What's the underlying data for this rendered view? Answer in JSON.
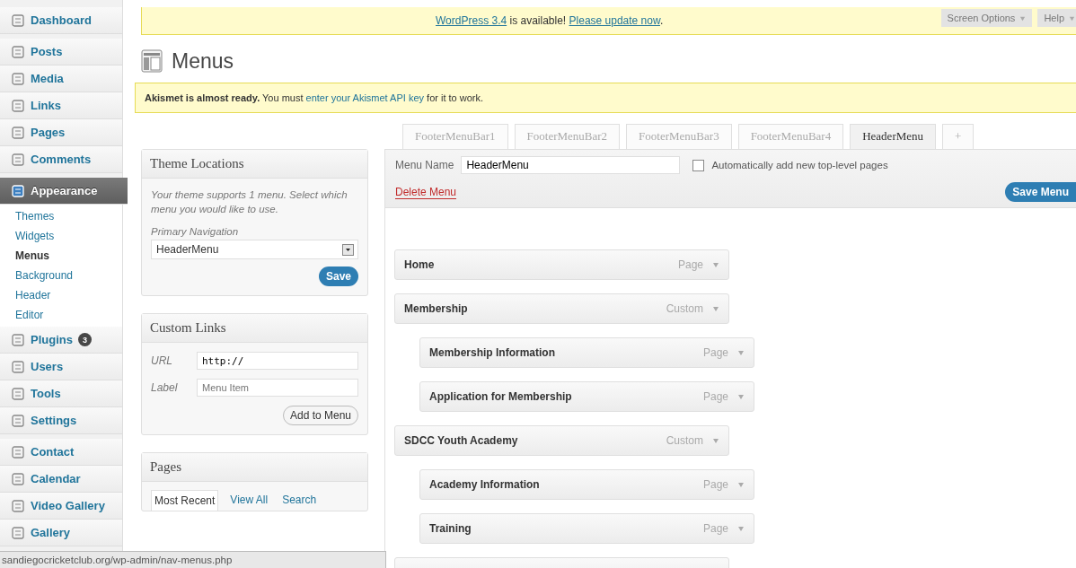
{
  "sidebar": {
    "groups": [
      {
        "items": [
          {
            "label": "Dashboard",
            "selected": false
          }
        ]
      },
      {
        "items": [
          {
            "label": "Posts",
            "selected": false
          },
          {
            "label": "Media",
            "selected": false
          },
          {
            "label": "Links",
            "selected": false
          },
          {
            "label": "Pages",
            "selected": false
          },
          {
            "label": "Comments",
            "selected": false
          }
        ]
      },
      {
        "items": [
          {
            "label": "Appearance",
            "selected": true,
            "children": [
              {
                "label": "Themes",
                "selected": false
              },
              {
                "label": "Widgets",
                "selected": false
              },
              {
                "label": "Menus",
                "selected": true
              },
              {
                "label": "Background",
                "selected": false
              },
              {
                "label": "Header",
                "selected": false
              },
              {
                "label": "Editor",
                "selected": false
              }
            ]
          },
          {
            "label": "Plugins",
            "selected": false,
            "badge": "3"
          },
          {
            "label": "Users",
            "selected": false
          },
          {
            "label": "Tools",
            "selected": false
          },
          {
            "label": "Settings",
            "selected": false
          }
        ]
      },
      {
        "items": [
          {
            "label": "Contact",
            "selected": false
          },
          {
            "label": "Calendar",
            "selected": false
          },
          {
            "label": "Video Gallery",
            "selected": false
          },
          {
            "label": "Gallery",
            "selected": false
          }
        ]
      }
    ]
  },
  "update_notice": {
    "link": "WordPress 3.4",
    "text": "is available!",
    "action": "Please update now",
    "end": "."
  },
  "screen_tabs": [
    "Screen Options",
    "Help"
  ],
  "page_title": "Menus",
  "akismet_notice": {
    "bold": "Akismet is almost ready.",
    "text": "You must",
    "link": "enter your Akismet API key",
    "end": "for it to work."
  },
  "theme_locations": {
    "title": "Theme Locations",
    "description": "Your theme supports 1 menu. Select which menu you would like to use.",
    "field_label": "Primary Navigation",
    "value": "HeaderMenu",
    "button": "Save"
  },
  "custom_links": {
    "title": "Custom Links",
    "url_label": "URL",
    "url_value": "http://",
    "label_label": "Label",
    "label_placeholder": "Menu Item",
    "button": "Add to Menu"
  },
  "pages_box": {
    "title": "Pages",
    "tabs": [
      {
        "label": "Most Recent",
        "selected": true
      },
      {
        "label": "View All",
        "selected": false
      },
      {
        "label": "Search",
        "selected": false
      }
    ]
  },
  "menu_tabs": [
    {
      "label": "FooterMenuBar1",
      "selected": false
    },
    {
      "label": "FooterMenuBar2",
      "selected": false
    },
    {
      "label": "FooterMenuBar3",
      "selected": false
    },
    {
      "label": "FooterMenuBar4",
      "selected": false
    },
    {
      "label": "HeaderMenu",
      "selected": true
    },
    {
      "label": "+",
      "selected": false
    }
  ],
  "menu_editor": {
    "name_label": "Menu Name",
    "name_value": "HeaderMenu",
    "auto_add_label": "Automatically add new top-level pages",
    "auto_add_checked": false,
    "delete": "Delete Menu",
    "save": "Save Menu"
  },
  "menu_items": [
    {
      "title": "Home",
      "type": "Page"
    },
    {
      "title": "Membership",
      "type": "Custom",
      "children": [
        {
          "title": "Membership Information",
          "type": "Page"
        },
        {
          "title": "Application for Membership",
          "type": "Page"
        }
      ]
    },
    {
      "title": "SDCC Youth Academy",
      "type": "Custom",
      "children": [
        {
          "title": "Academy Information",
          "type": "Page"
        },
        {
          "title": "Training",
          "type": "Page"
        }
      ]
    }
  ],
  "status_bar": "sandiegocricketclub.org/wp-admin/nav-menus.php"
}
